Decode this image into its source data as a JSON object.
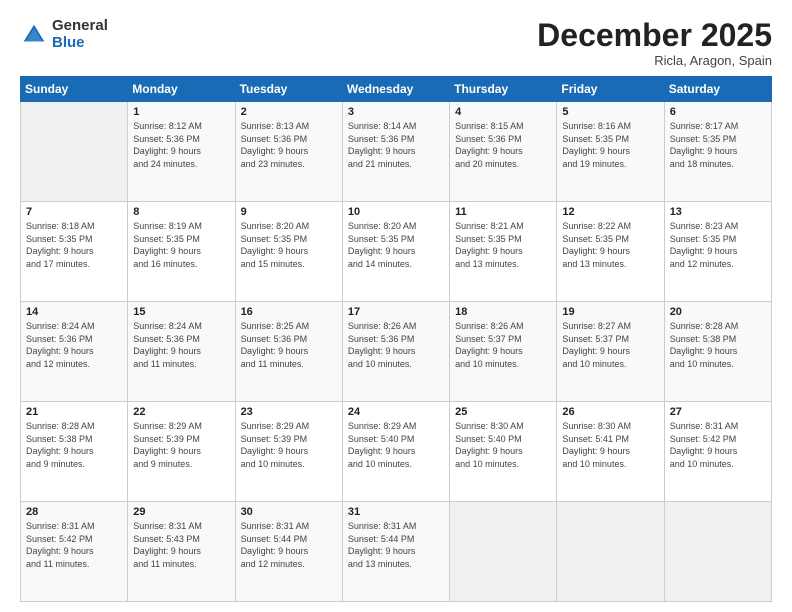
{
  "logo": {
    "general": "General",
    "blue": "Blue"
  },
  "header": {
    "month": "December 2025",
    "location": "Ricla, Aragon, Spain"
  },
  "weekdays": [
    "Sunday",
    "Monday",
    "Tuesday",
    "Wednesday",
    "Thursday",
    "Friday",
    "Saturday"
  ],
  "weeks": [
    [
      {
        "day": "",
        "info": ""
      },
      {
        "day": "1",
        "info": "Sunrise: 8:12 AM\nSunset: 5:36 PM\nDaylight: 9 hours\nand 24 minutes."
      },
      {
        "day": "2",
        "info": "Sunrise: 8:13 AM\nSunset: 5:36 PM\nDaylight: 9 hours\nand 23 minutes."
      },
      {
        "day": "3",
        "info": "Sunrise: 8:14 AM\nSunset: 5:36 PM\nDaylight: 9 hours\nand 21 minutes."
      },
      {
        "day": "4",
        "info": "Sunrise: 8:15 AM\nSunset: 5:36 PM\nDaylight: 9 hours\nand 20 minutes."
      },
      {
        "day": "5",
        "info": "Sunrise: 8:16 AM\nSunset: 5:35 PM\nDaylight: 9 hours\nand 19 minutes."
      },
      {
        "day": "6",
        "info": "Sunrise: 8:17 AM\nSunset: 5:35 PM\nDaylight: 9 hours\nand 18 minutes."
      }
    ],
    [
      {
        "day": "7",
        "info": "Sunrise: 8:18 AM\nSunset: 5:35 PM\nDaylight: 9 hours\nand 17 minutes."
      },
      {
        "day": "8",
        "info": "Sunrise: 8:19 AM\nSunset: 5:35 PM\nDaylight: 9 hours\nand 16 minutes."
      },
      {
        "day": "9",
        "info": "Sunrise: 8:20 AM\nSunset: 5:35 PM\nDaylight: 9 hours\nand 15 minutes."
      },
      {
        "day": "10",
        "info": "Sunrise: 8:20 AM\nSunset: 5:35 PM\nDaylight: 9 hours\nand 14 minutes."
      },
      {
        "day": "11",
        "info": "Sunrise: 8:21 AM\nSunset: 5:35 PM\nDaylight: 9 hours\nand 13 minutes."
      },
      {
        "day": "12",
        "info": "Sunrise: 8:22 AM\nSunset: 5:35 PM\nDaylight: 9 hours\nand 13 minutes."
      },
      {
        "day": "13",
        "info": "Sunrise: 8:23 AM\nSunset: 5:35 PM\nDaylight: 9 hours\nand 12 minutes."
      }
    ],
    [
      {
        "day": "14",
        "info": "Sunrise: 8:24 AM\nSunset: 5:36 PM\nDaylight: 9 hours\nand 12 minutes."
      },
      {
        "day": "15",
        "info": "Sunrise: 8:24 AM\nSunset: 5:36 PM\nDaylight: 9 hours\nand 11 minutes."
      },
      {
        "day": "16",
        "info": "Sunrise: 8:25 AM\nSunset: 5:36 PM\nDaylight: 9 hours\nand 11 minutes."
      },
      {
        "day": "17",
        "info": "Sunrise: 8:26 AM\nSunset: 5:36 PM\nDaylight: 9 hours\nand 10 minutes."
      },
      {
        "day": "18",
        "info": "Sunrise: 8:26 AM\nSunset: 5:37 PM\nDaylight: 9 hours\nand 10 minutes."
      },
      {
        "day": "19",
        "info": "Sunrise: 8:27 AM\nSunset: 5:37 PM\nDaylight: 9 hours\nand 10 minutes."
      },
      {
        "day": "20",
        "info": "Sunrise: 8:28 AM\nSunset: 5:38 PM\nDaylight: 9 hours\nand 10 minutes."
      }
    ],
    [
      {
        "day": "21",
        "info": "Sunrise: 8:28 AM\nSunset: 5:38 PM\nDaylight: 9 hours\nand 9 minutes."
      },
      {
        "day": "22",
        "info": "Sunrise: 8:29 AM\nSunset: 5:39 PM\nDaylight: 9 hours\nand 9 minutes."
      },
      {
        "day": "23",
        "info": "Sunrise: 8:29 AM\nSunset: 5:39 PM\nDaylight: 9 hours\nand 10 minutes."
      },
      {
        "day": "24",
        "info": "Sunrise: 8:29 AM\nSunset: 5:40 PM\nDaylight: 9 hours\nand 10 minutes."
      },
      {
        "day": "25",
        "info": "Sunrise: 8:30 AM\nSunset: 5:40 PM\nDaylight: 9 hours\nand 10 minutes."
      },
      {
        "day": "26",
        "info": "Sunrise: 8:30 AM\nSunset: 5:41 PM\nDaylight: 9 hours\nand 10 minutes."
      },
      {
        "day": "27",
        "info": "Sunrise: 8:31 AM\nSunset: 5:42 PM\nDaylight: 9 hours\nand 10 minutes."
      }
    ],
    [
      {
        "day": "28",
        "info": "Sunrise: 8:31 AM\nSunset: 5:42 PM\nDaylight: 9 hours\nand 11 minutes."
      },
      {
        "day": "29",
        "info": "Sunrise: 8:31 AM\nSunset: 5:43 PM\nDaylight: 9 hours\nand 11 minutes."
      },
      {
        "day": "30",
        "info": "Sunrise: 8:31 AM\nSunset: 5:44 PM\nDaylight: 9 hours\nand 12 minutes."
      },
      {
        "day": "31",
        "info": "Sunrise: 8:31 AM\nSunset: 5:44 PM\nDaylight: 9 hours\nand 13 minutes."
      },
      {
        "day": "",
        "info": ""
      },
      {
        "day": "",
        "info": ""
      },
      {
        "day": "",
        "info": ""
      }
    ]
  ]
}
